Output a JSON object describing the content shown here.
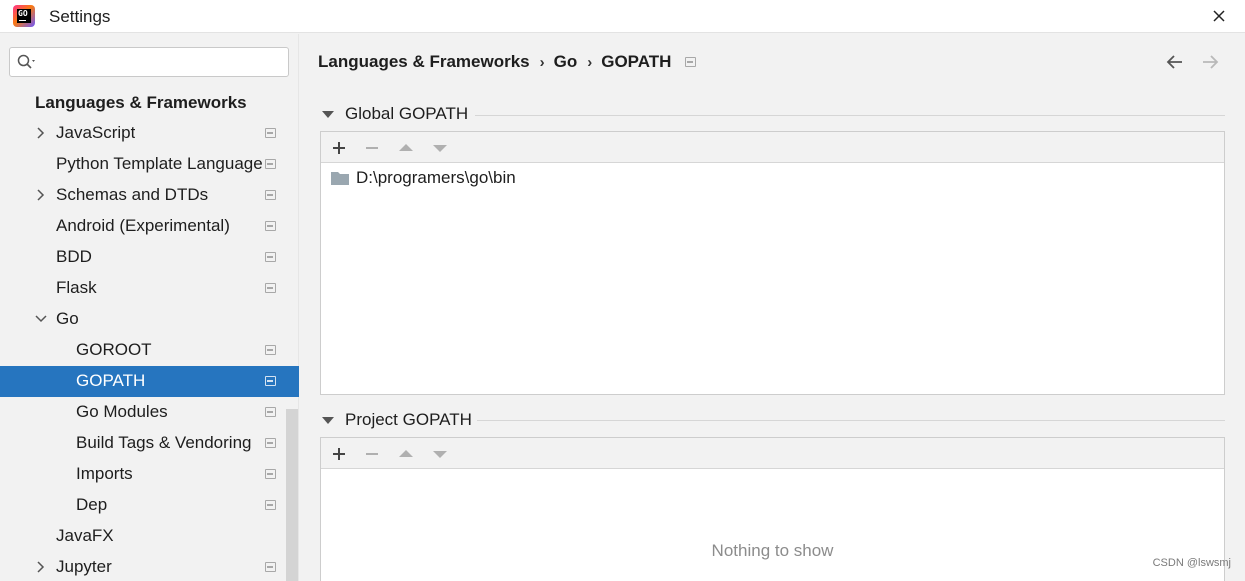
{
  "window": {
    "title": "Settings"
  },
  "sidebar": {
    "search": {
      "value": "",
      "placeholder": ""
    },
    "header": "Languages & Frameworks",
    "items": [
      {
        "label": "JavaScript",
        "level": 1,
        "expandable": true,
        "expanded": false,
        "project_icon": true,
        "selected": false
      },
      {
        "label": "Python Template Languages",
        "level": 1,
        "expandable": false,
        "project_icon": true,
        "selected": false
      },
      {
        "label": "Schemas and DTDs",
        "level": 1,
        "expandable": true,
        "expanded": false,
        "project_icon": true,
        "selected": false
      },
      {
        "label": "Android (Experimental)",
        "level": 1,
        "expandable": false,
        "project_icon": true,
        "selected": false
      },
      {
        "label": "BDD",
        "level": 1,
        "expandable": false,
        "project_icon": true,
        "selected": false
      },
      {
        "label": "Flask",
        "level": 1,
        "expandable": false,
        "project_icon": true,
        "selected": false
      },
      {
        "label": "Go",
        "level": 1,
        "expandable": true,
        "expanded": true,
        "project_icon": false,
        "selected": false
      },
      {
        "label": "GOROOT",
        "level": 2,
        "expandable": false,
        "project_icon": true,
        "selected": false
      },
      {
        "label": "GOPATH",
        "level": 2,
        "expandable": false,
        "project_icon": true,
        "selected": true
      },
      {
        "label": "Go Modules",
        "level": 2,
        "expandable": false,
        "project_icon": true,
        "selected": false
      },
      {
        "label": "Build Tags & Vendoring",
        "level": 2,
        "expandable": false,
        "project_icon": true,
        "selected": false
      },
      {
        "label": "Imports",
        "level": 2,
        "expandable": false,
        "project_icon": true,
        "selected": false
      },
      {
        "label": "Dep",
        "level": 2,
        "expandable": false,
        "project_icon": true,
        "selected": false
      },
      {
        "label": "JavaFX",
        "level": 1,
        "expandable": false,
        "project_icon": false,
        "selected": false
      },
      {
        "label": "Jupyter",
        "level": 1,
        "expandable": true,
        "expanded": false,
        "project_icon": true,
        "selected": false
      }
    ]
  },
  "breadcrumb": [
    "Languages & Frameworks",
    "Go",
    "GOPATH"
  ],
  "breadcrumb_separator": "›",
  "global_gopath": {
    "title": "Global GOPATH",
    "entries": [
      "D:\\programers\\go\\bin"
    ]
  },
  "project_gopath": {
    "title": "Project GOPATH",
    "entries": [],
    "empty_text": "Nothing to show"
  },
  "watermark": "CSDN @lswsmj",
  "colors": {
    "selection": "#2675bf",
    "background": "#f2f2f2",
    "folder": "#9aa7b0"
  }
}
